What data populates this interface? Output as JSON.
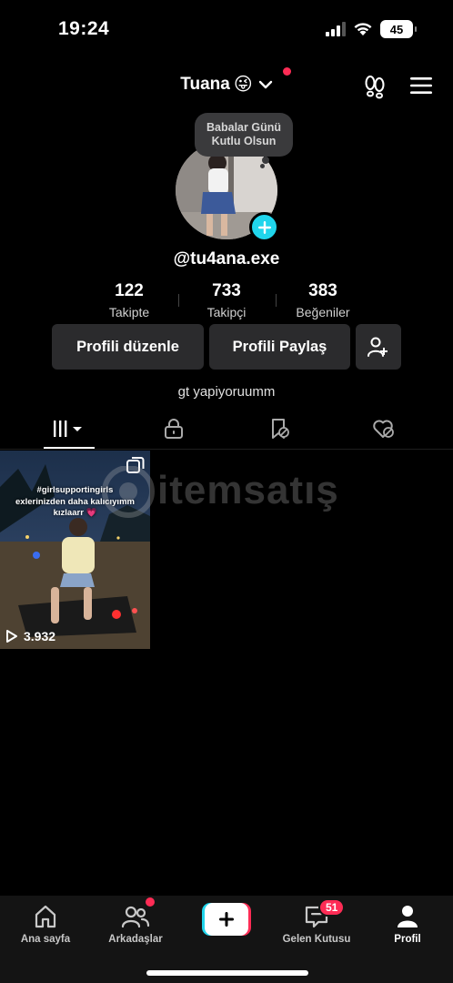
{
  "status_bar": {
    "time": "19:24",
    "battery": "45"
  },
  "header": {
    "username": "Tuana",
    "emoji": "😜"
  },
  "note": {
    "line1": "Babalar Günü",
    "line2": "Kutlu Olsun"
  },
  "profile": {
    "handle": "@tu4ana.exe",
    "bio": "gt yapiyoruumm"
  },
  "stats": [
    {
      "value": "122",
      "label": "Takipte"
    },
    {
      "value": "733",
      "label": "Takipçi"
    },
    {
      "value": "383",
      "label": "Beğeniler"
    }
  ],
  "actions": {
    "edit": "Profili düzenle",
    "share": "Profili Paylaş"
  },
  "video": {
    "caption_line1": "#girlsupportingirls",
    "caption_line2": "exlerinizden daha kalıcıyımm",
    "caption_line3": "kızlaarr 💗",
    "views": "3.932"
  },
  "watermark": "itemsatış",
  "nav": {
    "home": "Ana sayfa",
    "friends": "Arkadaşlar",
    "inbox": "Gelen Kutusu",
    "inbox_badge": "51",
    "profile": "Profil"
  },
  "colors": {
    "accent": "#fe2c55",
    "cyan": "#20d5ec",
    "button_bg": "#2b2b2d"
  }
}
